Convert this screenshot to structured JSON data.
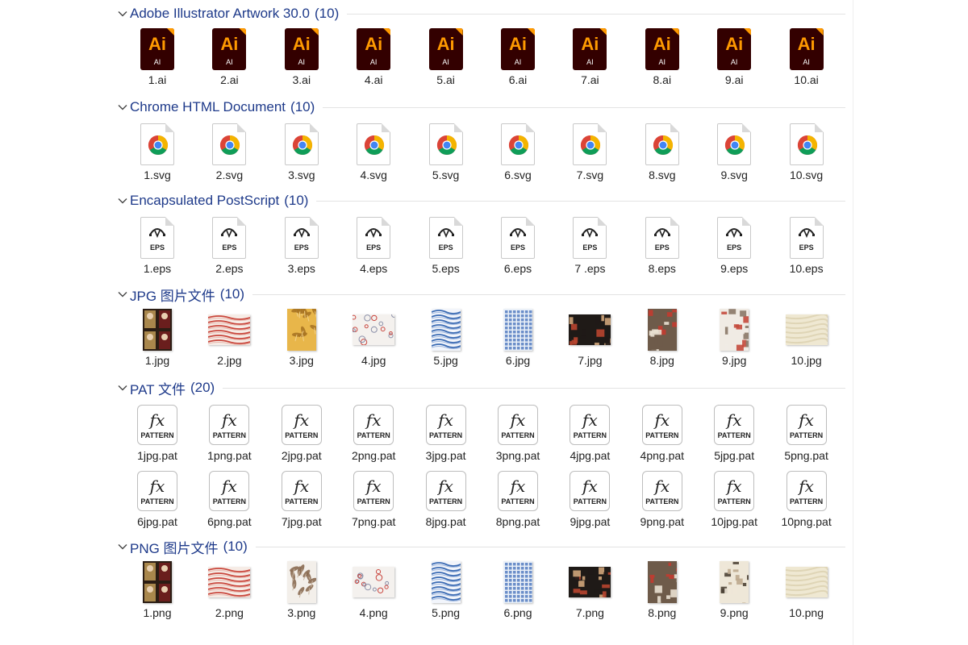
{
  "groups": [
    {
      "id": "ai",
      "title": "Adobe Illustrator Artwork 30.0",
      "count": "(10)",
      "icon_type": "ai-file-icon",
      "icon_big": "Ai",
      "icon_small": "AI",
      "files": [
        "1.ai",
        "2.ai",
        "3.ai",
        "4.ai",
        "5.ai",
        "6.ai",
        "7.ai",
        "8.ai",
        "9.ai",
        "10.ai"
      ]
    },
    {
      "id": "svg",
      "title": "Chrome HTML Document",
      "count": "(10)",
      "icon_type": "chrome-document-icon",
      "files": [
        "1.svg",
        "2.svg",
        "3.svg",
        "4.svg",
        "5.svg",
        "6.svg",
        "7.svg",
        "8.svg",
        "9.svg",
        "10.svg"
      ]
    },
    {
      "id": "eps",
      "title": "Encapsulated PostScript",
      "count": "(10)",
      "icon_type": "eps-file-icon",
      "icon_label": "EPS",
      "files": [
        "1.eps",
        "2.eps",
        "3.eps",
        "4.eps",
        "5.eps",
        "6.eps",
        "7 .eps",
        "8.eps",
        "9.eps",
        "10.eps"
      ]
    },
    {
      "id": "jpg",
      "title": "JPG 图片文件",
      "count": "(10)",
      "icon_type": "image-thumbnail",
      "files": [
        "1.jpg",
        "2.jpg",
        "3.jpg",
        "4.jpg",
        "5.jpg",
        "6.jpg",
        "7.jpg",
        "8.jpg",
        "9.jpg",
        "10.jpg"
      ]
    },
    {
      "id": "pat",
      "title": "PAT 文件",
      "count": "(20)",
      "icon_type": "pattern-file-icon",
      "icon_glyph": "fx",
      "icon_label": "PATTERN",
      "files": [
        "1jpg.pat",
        "1png.pat",
        "2jpg.pat",
        "2png.pat",
        "3jpg.pat",
        "3png.pat",
        "4jpg.pat",
        "4png.pat",
        "5jpg.pat",
        "5png.pat",
        "6jpg.pat",
        "6png.pat",
        "7jpg.pat",
        "7png.pat",
        "8jpg.pat",
        "8png.pat",
        "9jpg.pat",
        "9png.pat",
        "10jpg.pat",
        "10png.pat"
      ]
    },
    {
      "id": "png",
      "title": "PNG 图片文件",
      "count": "(10)",
      "icon_type": "image-thumbnail",
      "files": [
        "1.png",
        "2.png",
        "3.png",
        "4.png",
        "5.png",
        "6.png",
        "7.png",
        "8.png",
        "9.png",
        "10.png"
      ]
    }
  ],
  "colors": {
    "group_title": "#1e3a8a",
    "ai_body": "#330000",
    "ai_accent": "#ff9a00",
    "chrome_red": "#db4437",
    "chrome_green": "#0f9d58",
    "chrome_yellow": "#f4b400",
    "chrome_blue": "#4285f4"
  },
  "thumbnails": {
    "jpg": [
      {
        "style": "portrait-figures",
        "colors": [
          "#2b1d14",
          "#c9a35a",
          "#7a1f1f"
        ]
      },
      {
        "style": "red-waves",
        "colors": [
          "#f6ece6",
          "#c9473d",
          "#e8b7ad"
        ]
      },
      {
        "style": "golden-leaves",
        "colors": [
          "#e8b64a",
          "#a87423",
          "#f2d18a"
        ]
      },
      {
        "style": "floral-dots",
        "colors": [
          "#f4f1ee",
          "#c9463f",
          "#8a8fa8"
        ]
      },
      {
        "style": "blue-waves",
        "colors": [
          "#f2f5fb",
          "#3b6bb3",
          "#9db6de"
        ]
      },
      {
        "style": "blue-grid",
        "colors": [
          "#eaf0f8",
          "#4b76bd",
          "#a8bde0"
        ]
      },
      {
        "style": "dark-floral",
        "colors": [
          "#1f1a17",
          "#b8452f",
          "#cfa57a"
        ]
      },
      {
        "style": "mosaic",
        "colors": [
          "#6e5b4a",
          "#c23b30",
          "#e9e0d2"
        ]
      },
      {
        "style": "red-birds",
        "colors": [
          "#f0ebe4",
          "#c44a3c",
          "#8a7867"
        ]
      },
      {
        "style": "cream-marble",
        "colors": [
          "#efe8d2",
          "#d8cda9",
          "#f7f2e3"
        ]
      }
    ],
    "png": [
      {
        "style": "portrait-figures",
        "colors": [
          "#2b1d14",
          "#c9a35a",
          "#7a1f1f"
        ]
      },
      {
        "style": "red-waves",
        "colors": [
          "#f6ece6",
          "#c9473d",
          "#e8b7ad"
        ]
      },
      {
        "style": "branches",
        "colors": [
          "#f3efea",
          "#8a6a52",
          "#c9b6a3"
        ]
      },
      {
        "style": "floral-dots",
        "colors": [
          "#f4f1ee",
          "#c9463f",
          "#8a8fa8"
        ]
      },
      {
        "style": "blue-waves",
        "colors": [
          "#f2f5fb",
          "#3b6bb3",
          "#9db6de"
        ]
      },
      {
        "style": "blue-grid",
        "colors": [
          "#eaf0f8",
          "#4b76bd",
          "#a8bde0"
        ]
      },
      {
        "style": "dark-floral",
        "colors": [
          "#1f1a17",
          "#b8452f",
          "#cfa57a"
        ]
      },
      {
        "style": "mosaic",
        "colors": [
          "#6e5b4a",
          "#c23b30",
          "#e9e0d2"
        ]
      },
      {
        "style": "cream-motifs",
        "colors": [
          "#eee7d8",
          "#4d4236",
          "#bca98e"
        ]
      },
      {
        "style": "cream-marble",
        "colors": [
          "#efe8d2",
          "#d8cda9",
          "#f7f2e3"
        ]
      }
    ]
  }
}
